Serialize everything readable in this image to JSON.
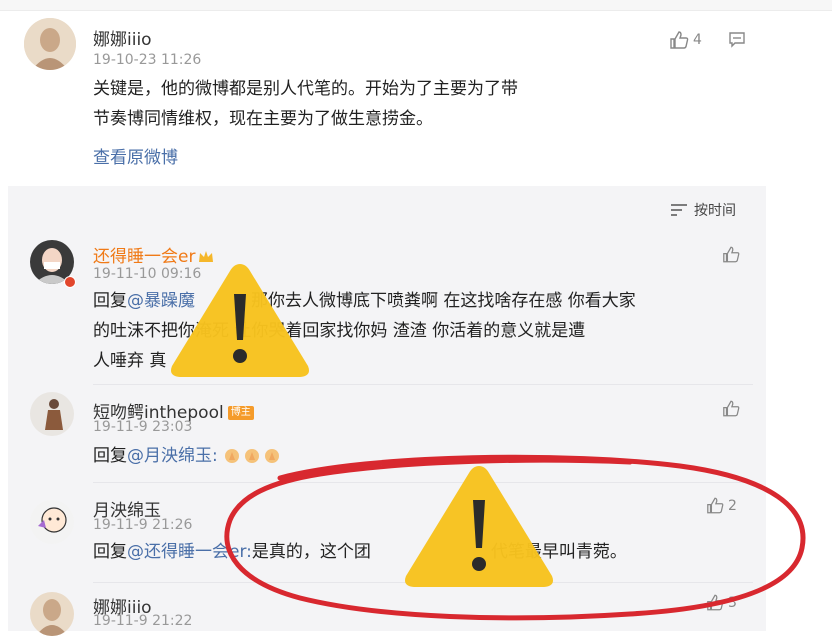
{
  "post": {
    "author": "娜娜iiio",
    "time": "19-10-23 11:26",
    "likes": "4",
    "text_line1": "关键是，他的微博都是别人代笔的。开始为了主要为了带",
    "text_line2": "节奏博同情维权，现在主要为了做生意捞金。",
    "view_original": "查看原微博"
  },
  "sort": {
    "label": "按时间",
    "icon": "sort-icon"
  },
  "replies": [
    {
      "author": "还得睡一会er",
      "time": "19-11-10 09:16",
      "line1_prefix": "回复",
      "line1_mention": "@暴躁魔",
      "line1_rest": "那你去人微博底下喷粪啊 在这找啥存在感 你看大家",
      "line2": "的吐沫不把你淹死 让你哭着回家找你妈 渣渣 你活着的意义就是遭",
      "line3": "人唾弃 真"
    },
    {
      "author": "短吻鳄inthepool",
      "badge": "博主",
      "time": "19-11-9 23:03",
      "prefix": "回复",
      "mention": "@月泱绵玉:"
    },
    {
      "author": "月泱绵玉",
      "time": "19-11-9 21:26",
      "likes": "2",
      "prefix": "回复",
      "mention": "@还得睡一会er:",
      "text_a": "是真的，这个团",
      "text_b": "代笔最早叫青菀。"
    },
    {
      "author": "娜娜iiio",
      "time": "19-11-9 21:22",
      "likes": "3"
    }
  ],
  "colors": {
    "link": "#4a6fa8",
    "warning": "#f7c21e",
    "circle": "#d8282f",
    "panel": "#f4f4f6"
  }
}
